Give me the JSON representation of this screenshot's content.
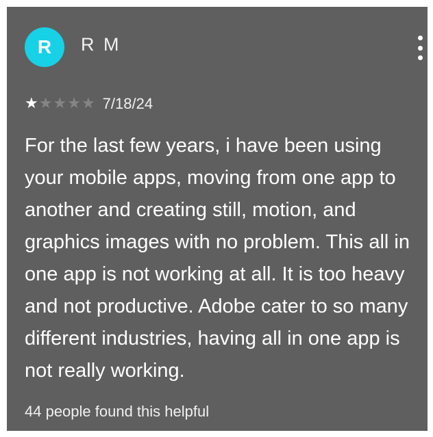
{
  "review": {
    "avatar_initial": "R",
    "author": "R M",
    "rating": 1,
    "rating_max": 5,
    "date": "7/18/24",
    "text": "For the last few years, i have been using your mobile apps, moving from one app to another and creating still, motion, and graphics images with no problem. This all in one app is not working at all. It is too heavy and not productive. Adobe cater to so many different industries, having all in one app is not really working.",
    "helpful_text": "44 people found this helpful"
  },
  "icons": {
    "menu": "more-vert-icon",
    "star": "star-icon"
  },
  "colors": {
    "card_background": "#5f5f5f",
    "avatar_background": "#17d1e6",
    "star_filled": "#ffffff",
    "star_empty": "#858585",
    "text": "#ffffff"
  }
}
